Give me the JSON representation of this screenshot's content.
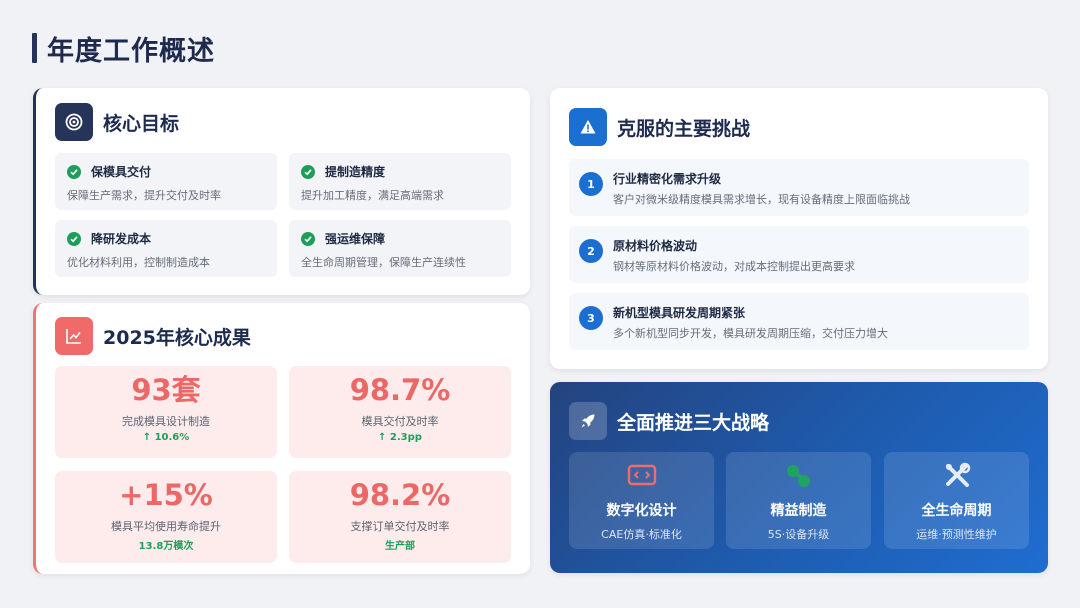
{
  "page": {
    "title": "年度工作概述"
  },
  "goals": {
    "title": "核心目标",
    "items": [
      {
        "title": "保模具交付",
        "desc": "保障生产需求，提升交付及时率"
      },
      {
        "title": "提制造精度",
        "desc": "提升加工精度，满足高端需求"
      },
      {
        "title": "降研发成本",
        "desc": "优化材料利用，控制制造成本"
      },
      {
        "title": "强运维保障",
        "desc": "全生命周期管理，保障生产连续性"
      }
    ]
  },
  "results": {
    "title": "2025年核心成果",
    "items": [
      {
        "value": "93套",
        "label": "完成模具设计制造",
        "sub": "↑ 10.6%"
      },
      {
        "value": "98.7%",
        "label": "模具交付及时率",
        "sub": "↑ 2.3pp"
      },
      {
        "value": "+15%",
        "label": "模具平均使用寿命提升",
        "sub": "13.8万模次"
      },
      {
        "value": "98.2%",
        "label": "支撑订单交付及时率",
        "sub": "生产部"
      }
    ]
  },
  "challenges": {
    "title": "克服的主要挑战",
    "items": [
      {
        "num": "1",
        "title": "行业精密化需求升级",
        "desc": "客户对微米级精度模具需求增长，现有设备精度上限面临挑战"
      },
      {
        "num": "2",
        "title": "原材料价格波动",
        "desc": "钢材等原材料价格波动，对成本控制提出更高要求"
      },
      {
        "num": "3",
        "title": "新机型模具研发周期紧张",
        "desc": "多个新机型同步开发，模具研发周期压缩，交付压力增大"
      }
    ]
  },
  "strategy": {
    "title": "全面推进三大战略",
    "items": [
      {
        "title": "数字化设计",
        "desc": "CAE仿真·标准化",
        "icon": "code-window-icon"
      },
      {
        "title": "精益制造",
        "desc": "5S·设备升级",
        "icon": "link-icon"
      },
      {
        "title": "全生命周期",
        "desc": "运维·预测性维护",
        "icon": "tools-icon"
      }
    ]
  },
  "colors": {
    "navy": "#273459",
    "coral": "#ec6866",
    "blue": "#1b6fd0",
    "green": "#1e9e5a"
  }
}
